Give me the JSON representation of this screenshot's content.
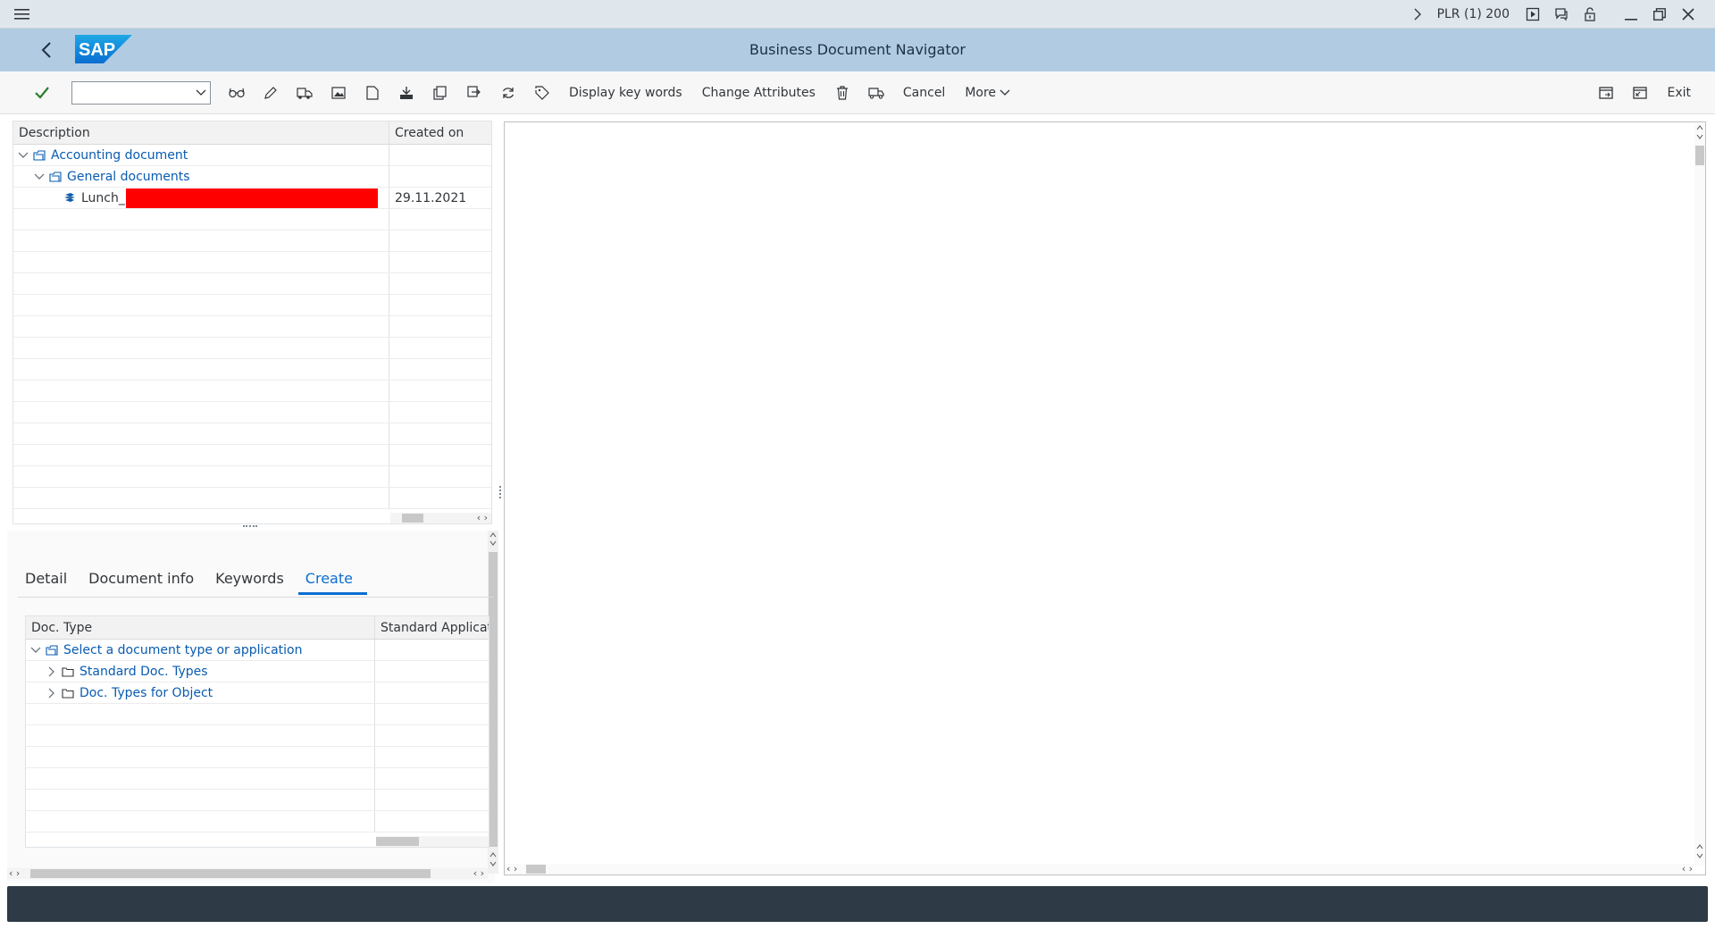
{
  "titlebar": {
    "system": "PLR (1) 200"
  },
  "shell": {
    "logo_text": "SAP",
    "title": "Business Document Navigator"
  },
  "toolbar": {
    "display_key_words": "Display key words",
    "change_attributes": "Change Attributes",
    "cancel": "Cancel",
    "more": "More",
    "exit": "Exit",
    "command_value": ""
  },
  "tree": {
    "headers": {
      "description": "Description",
      "created_on": "Created on"
    },
    "rows": [
      {
        "label": "Accounting document",
        "created_on": ""
      },
      {
        "label": "General documents",
        "created_on": ""
      },
      {
        "label": "Lunch_",
        "created_on": "29.11.2021"
      }
    ]
  },
  "tabs": [
    {
      "label": "Detail"
    },
    {
      "label": "Document info"
    },
    {
      "label": "Keywords"
    },
    {
      "label": "Create",
      "active": true
    }
  ],
  "doctable": {
    "headers": {
      "doc_type": "Doc. Type",
      "standard_application": "Standard Applicatio"
    },
    "rows": [
      {
        "label": "Select a document type or application"
      },
      {
        "label": "Standard Doc. Types"
      },
      {
        "label": "Doc. Types for Object"
      }
    ]
  },
  "colors": {
    "titlebar": "#dfe6ec",
    "shell": "#b1cbe2",
    "link": "#0a5bb0",
    "active_tab": "#0a6ed1",
    "status_bar": "#2e3a46",
    "redaction": "#ff0000"
  },
  "icons": {
    "menu": "hamburger-icon",
    "back": "chevron-left-icon",
    "check": "checkmark-icon",
    "folder": "folder-icon",
    "document": "document-stack-icon"
  }
}
